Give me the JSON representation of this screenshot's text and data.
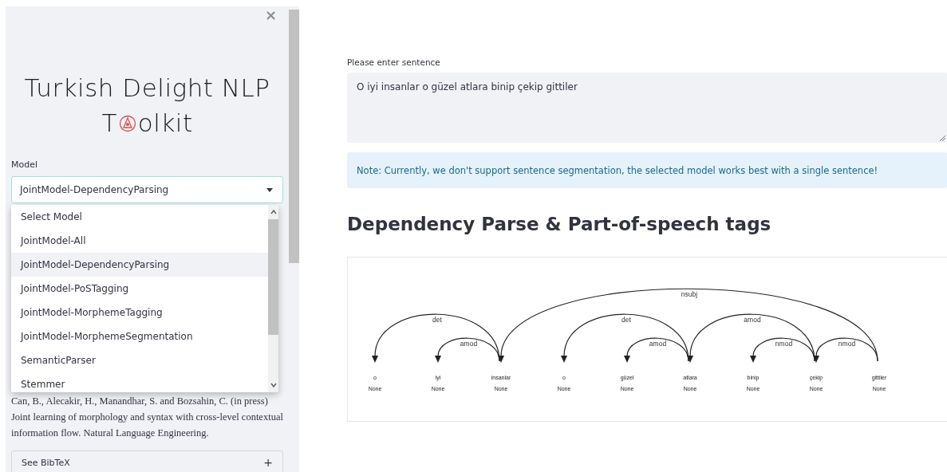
{
  "sidebar": {
    "close": "×",
    "title_line1": "Turkish Delight NLP",
    "title_before_logo": "T",
    "title_after_logo": "olkit",
    "model_label": "Model",
    "model_value": "JointModel-DependencyParsing",
    "model_options": [
      {
        "label": "Select Model",
        "selected": false
      },
      {
        "label": "JointModel-All",
        "selected": false
      },
      {
        "label": "JointModel-DependencyParsing",
        "selected": true
      },
      {
        "label": "JointModel-PoSTagging",
        "selected": false
      },
      {
        "label": "JointModel-MorphemeTagging",
        "selected": false
      },
      {
        "label": "JointModel-MorphemeSegmentation",
        "selected": false
      },
      {
        "label": "SemanticParser",
        "selected": false
      },
      {
        "label": "Stemmer",
        "selected": false
      }
    ],
    "citation": "Can, B., Alecakir, H., Manandhar, S. and Bozsahin, C. (in press) Joint learning of morphology and syntax with cross-level contextual information flow. Natural Language Engineering.",
    "bibtex": {
      "label": "See BibTeX",
      "toggle": "+",
      "expanded": false
    }
  },
  "main": {
    "input_label": "Please enter sentence",
    "input_value": "O iyi insanlar o güzel atlara binip çekip gittiler",
    "note": "Note: Currently, we don't support sentence segmentation, the selected model works best with a single sentence!",
    "heading": "Dependency Parse & Part-of-speech tags",
    "parse": {
      "tokens": [
        {
          "word": "o",
          "tag": "None",
          "relation": "det"
        },
        {
          "word": "iyi",
          "tag": "None",
          "relation": "amod"
        },
        {
          "word": "insanlar",
          "tag": "None",
          "relation": "nsubj"
        },
        {
          "word": "o",
          "tag": "None",
          "relation": "det"
        },
        {
          "word": "güzel",
          "tag": "None",
          "relation": "amod"
        },
        {
          "word": "atlara",
          "tag": "None",
          "relation": "amod"
        },
        {
          "word": "binip",
          "tag": "None",
          "relation": "nmod"
        },
        {
          "word": "çekip",
          "tag": "None",
          "relation": "nmod"
        },
        {
          "word": "gittiler",
          "tag": "None"
        }
      ]
    }
  }
}
